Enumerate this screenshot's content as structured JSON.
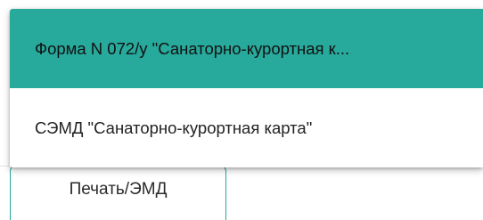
{
  "menu": {
    "items": [
      {
        "label": "Форма N 072/у \"Санаторно-курортная к...",
        "active": true
      },
      {
        "label": "СЭМД \"Санаторно-курортная карта\"",
        "active": false
      }
    ]
  },
  "print_button": {
    "label": "Печать/ЭМД"
  },
  "colors": {
    "accent": "#27a99b",
    "text": "#222222"
  }
}
